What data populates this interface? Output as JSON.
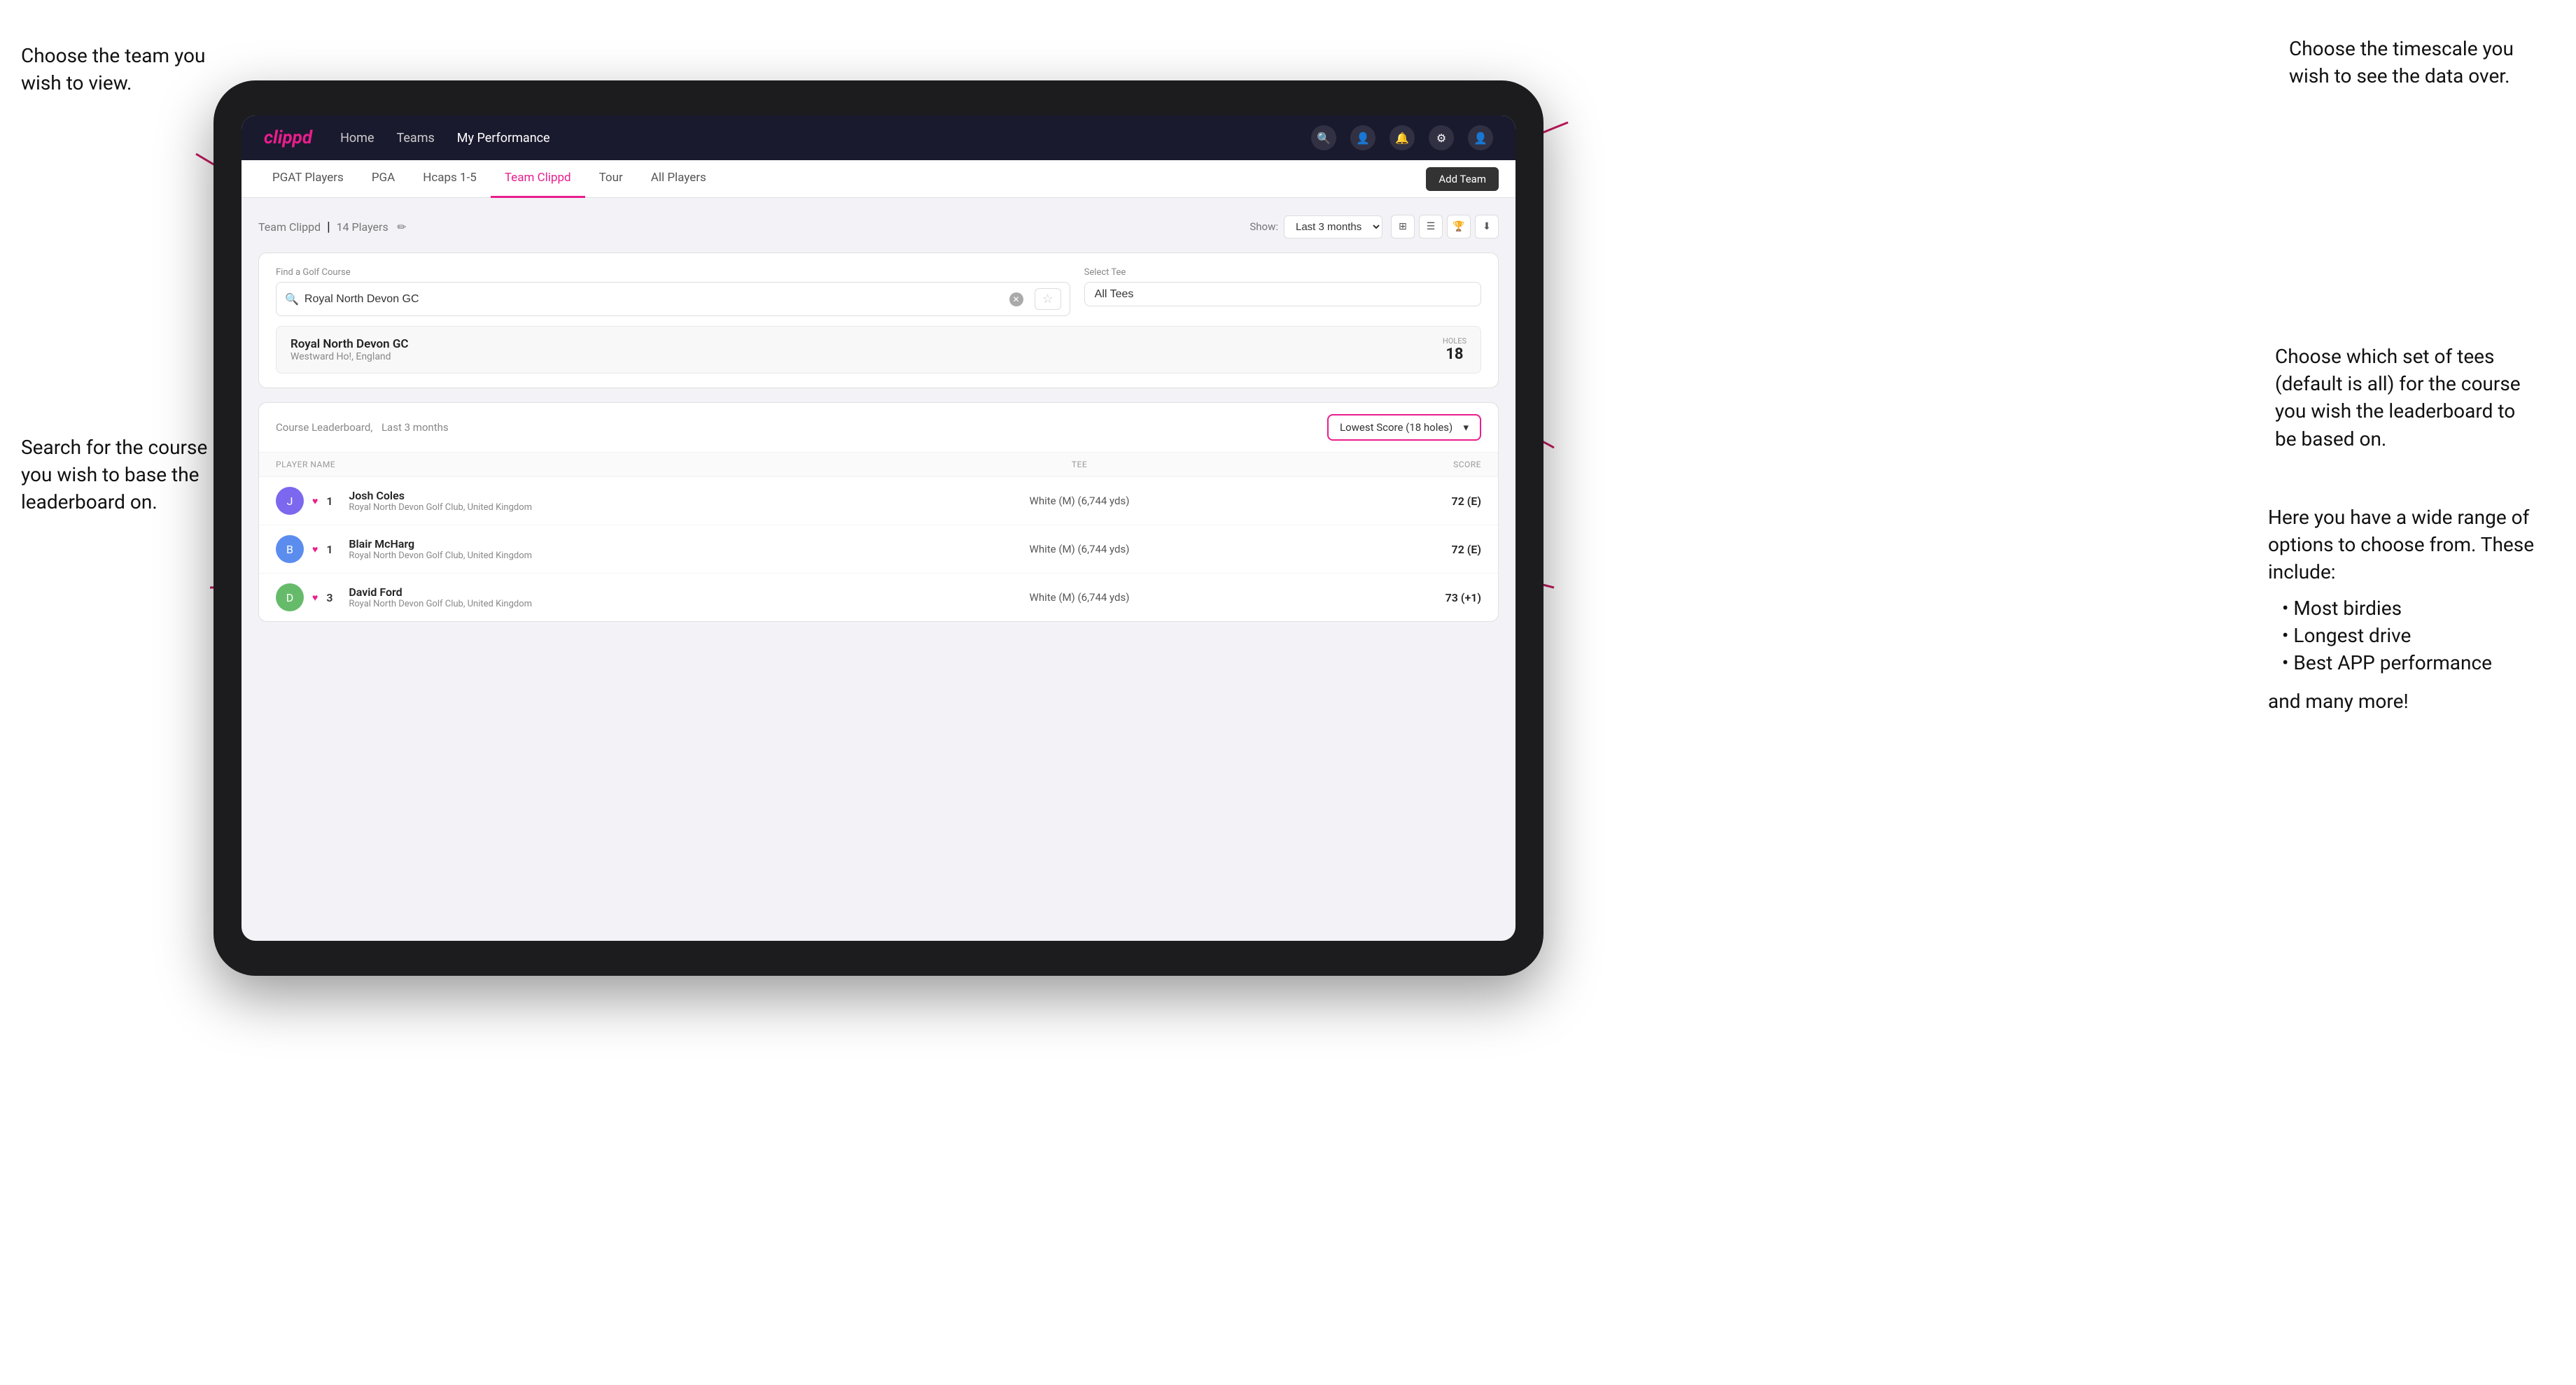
{
  "annotations": {
    "top_left": {
      "line1": "Choose the team you",
      "line2": "wish to view."
    },
    "bottom_left": {
      "line1": "Search for the course",
      "line2": "you wish to base the",
      "line3": "leaderboard on."
    },
    "top_right": {
      "line1": "Choose the timescale you",
      "line2": "wish to see the data over."
    },
    "mid_right": {
      "line1": "Choose which set of tees",
      "line2": "(default is all) for the course",
      "line3": "you wish the leaderboard to",
      "line4": "be based on."
    },
    "bottom_right": {
      "intro": "Here you have a wide range of options to choose from. These include:",
      "items": [
        "Most birdies",
        "Longest drive",
        "Best APP performance"
      ],
      "outro": "and many more!"
    }
  },
  "topnav": {
    "logo": "clippd",
    "links": [
      "Home",
      "Teams",
      "My Performance"
    ],
    "active_link": "My Performance"
  },
  "subnav": {
    "items": [
      "PGAT Players",
      "PGA",
      "Hcaps 1-5",
      "Team Clippd",
      "Tour",
      "All Players"
    ],
    "active_item": "Team Clippd",
    "add_team_label": "Add Team"
  },
  "team_header": {
    "title": "Team Clippd",
    "player_count": "14 Players",
    "show_label": "Show:",
    "show_value": "Last 3 months"
  },
  "search": {
    "find_label": "Find a Golf Course",
    "placeholder": "Royal North Devon GC",
    "select_tee_label": "Select Tee",
    "tee_value": "All Tees"
  },
  "course_result": {
    "name": "Royal North Devon GC",
    "location": "Westward Ho!, England",
    "holes_label": "Holes",
    "holes_count": "18"
  },
  "leaderboard": {
    "title": "Course Leaderboard,",
    "subtitle": "Last 3 months",
    "score_filter": "Lowest Score (18 holes)",
    "columns": {
      "player": "PLAYER NAME",
      "tee": "TEE",
      "score": "SCORE"
    },
    "rows": [
      {
        "rank": "1",
        "name": "Josh Coles",
        "club": "Royal North Devon Golf Club, United Kingdom",
        "tee": "White (M) (6,744 yds)",
        "score": "72 (E)",
        "avatar_letter": "J",
        "avatar_class": "avatar-1"
      },
      {
        "rank": "1",
        "name": "Blair McHarg",
        "club": "Royal North Devon Golf Club, United Kingdom",
        "tee": "White (M) (6,744 yds)",
        "score": "72 (E)",
        "avatar_letter": "B",
        "avatar_class": "avatar-2"
      },
      {
        "rank": "3",
        "name": "David Ford",
        "club": "Royal North Devon Golf Club, United Kingdom",
        "tee": "White (M) (6,744 yds)",
        "score": "73 (+1)",
        "avatar_letter": "D",
        "avatar_class": "avatar-3"
      }
    ]
  }
}
